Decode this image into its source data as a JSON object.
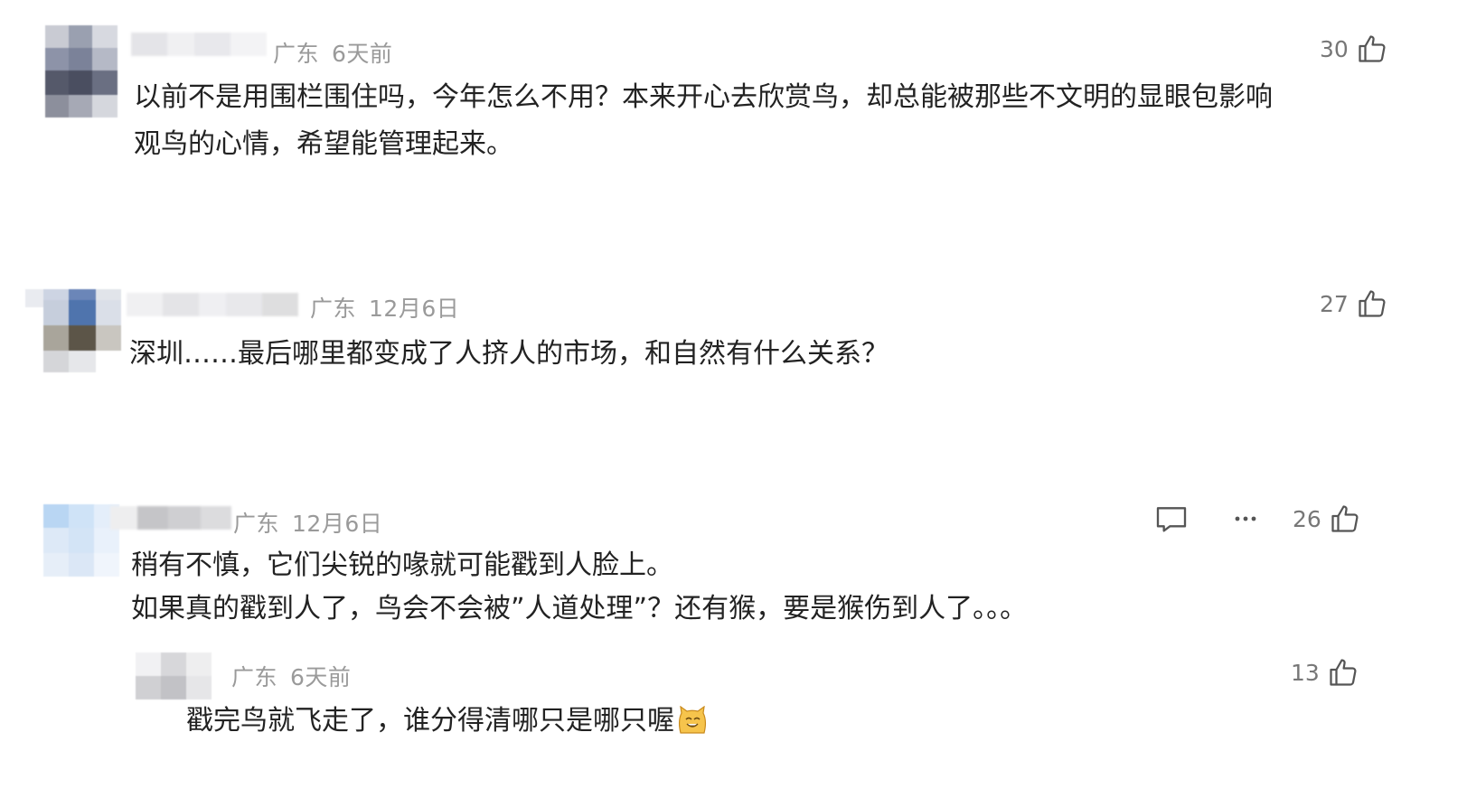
{
  "comments": [
    {
      "location": "广东",
      "time": "6天前",
      "likes": "30",
      "text_lines": [
        "以前不是用围栏围住吗，今年怎么不用？本来开心去欣赏鸟，却总能被那些不文明的显眼包影响",
        "观鸟的心情，希望能管理起来。"
      ]
    },
    {
      "location": "广东",
      "time": "12月6日",
      "likes": "27",
      "text_lines": [
        "深圳……最后哪里都变成了人挤人的市场，和自然有什么关系？"
      ]
    },
    {
      "location": "广东",
      "time": "12月6日",
      "likes": "26",
      "text_lines": [
        "稍有不慎，它们尖锐的喙就可能戳到人脸上。",
        "如果真的戳到人了，鸟会不会被”人道处理”？还有猴，要是猴伤到人了。。。"
      ],
      "reply": {
        "location": "广东",
        "time": "6天前",
        "likes": "13",
        "text": "戳完鸟就飞走了，谁分得清哪只是哪只喔",
        "emoji": "cat-face-emoji"
      }
    }
  ],
  "icons": {
    "like": "thumbs-up-icon",
    "reply": "comment-bubble-icon",
    "more": "more-dots-icon"
  },
  "colors": {
    "text": "#222222",
    "meta": "#9a9a9a",
    "icon": "#555555"
  }
}
